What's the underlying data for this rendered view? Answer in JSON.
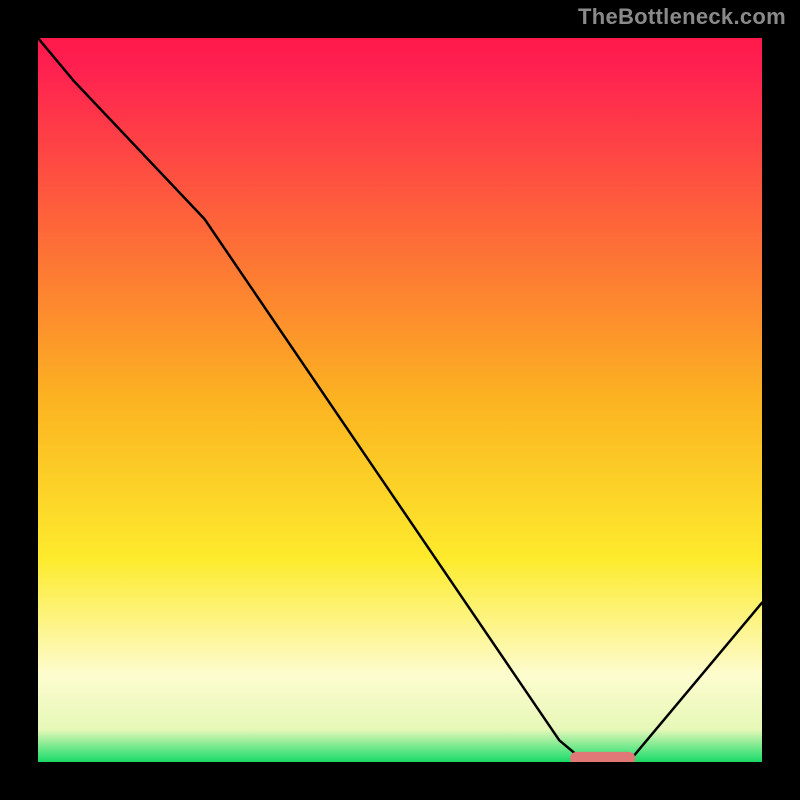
{
  "watermark": "TheBottleneck.com",
  "chart_data": {
    "type": "line",
    "title": "",
    "xlabel": "",
    "ylabel": "",
    "xlim": [
      0,
      100
    ],
    "ylim": [
      0,
      100
    ],
    "series": [
      {
        "name": "curve",
        "x": [
          0,
          5,
          23,
          72,
          75,
          82,
          100
        ],
        "y": [
          100,
          94,
          75,
          3,
          0.5,
          0.5,
          22
        ],
        "note": "y expressed as percent of plot height from bottom; the 0.5 plateau is the flat valley"
      }
    ],
    "annotations": [
      {
        "name": "valley-marker",
        "shape": "rounded-rect",
        "color": "#e17878",
        "x_center": 78,
        "y_center": 0.5,
        "width_pct": 9,
        "height_pct": 1.8
      }
    ],
    "background": {
      "type": "vertical-gradient",
      "stops": [
        {
          "offset": 0.0,
          "color": "#ff1a4b"
        },
        {
          "offset": 0.04,
          "color": "#ff2050"
        },
        {
          "offset": 0.5,
          "color": "#fcb321"
        },
        {
          "offset": 0.72,
          "color": "#fdeb2d"
        },
        {
          "offset": 0.88,
          "color": "#fdfccf"
        },
        {
          "offset": 0.955,
          "color": "#e6f8b8"
        },
        {
          "offset": 0.99,
          "color": "#44e27a"
        },
        {
          "offset": 1.0,
          "color": "#1bd765"
        }
      ]
    }
  }
}
